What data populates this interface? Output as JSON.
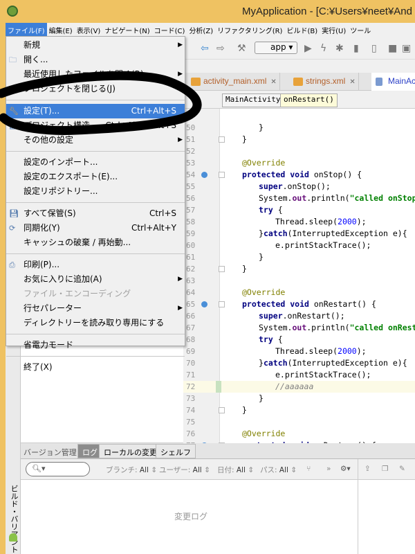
{
  "window": {
    "title": "MyApplication - [C:¥Users¥neet¥And"
  },
  "menubar": [
    "ファイル(F)",
    "編集(E)",
    "表示(V)",
    "ナビゲート(N)",
    "コード(C)",
    "分析(Z)",
    "リファクタリング(R)",
    "ビルド(B)",
    "実行(U)",
    "ツール"
  ],
  "toolbar": {
    "run_config": "app"
  },
  "tabs": [
    {
      "label": "activity_main.xml"
    },
    {
      "label": "strings.xml"
    },
    {
      "label": "MainAc"
    }
  ],
  "breadcrumb": [
    "MainActivity",
    "onRestart()"
  ],
  "file_menu": {
    "items": [
      {
        "label": "新規",
        "submenu": true
      },
      {
        "label": "開く...",
        "icon": "folder-icon"
      },
      {
        "label": "最近使用したファイルを開く(R)",
        "submenu": true
      },
      {
        "label": "プロジェクトを閉じる(J)"
      },
      {
        "sep": true
      },
      {
        "label": "設定(T)...",
        "shortcut": "Ctrl+Alt+S",
        "icon": "wrench-icon",
        "highlighted": true
      },
      {
        "label": "プロジェクト構造...",
        "shortcut": "Ctrl+Alt+Shift+S",
        "icon": "project-structure-icon"
      },
      {
        "label": "その他の設定",
        "submenu": true
      },
      {
        "sep": true
      },
      {
        "label": "設定のインポート..."
      },
      {
        "label": "設定のエクスポート(E)..."
      },
      {
        "label": "設定リポジトリー..."
      },
      {
        "sep": true
      },
      {
        "label": "すべて保管(S)",
        "shortcut": "Ctrl+S",
        "icon": "save-icon"
      },
      {
        "label": "同期化(Y)",
        "shortcut": "Ctrl+Alt+Y",
        "icon": "sync-icon"
      },
      {
        "label": "キャッシュの破棄 / 再始動..."
      },
      {
        "sep": true
      },
      {
        "label": "印刷(P)...",
        "icon": "print-icon"
      },
      {
        "label": "お気に入りに追加(A)",
        "submenu": true
      },
      {
        "label": "ファイル・エンコーディング",
        "disabled": true
      },
      {
        "label": "行セパレーター",
        "submenu": true
      },
      {
        "label": "ディレクトリーを読み取り専用にする"
      },
      {
        "sep": true
      },
      {
        "label": "省電力モード"
      },
      {
        "sep": true
      },
      {
        "label": "終了(X)"
      }
    ]
  },
  "code": [
    {
      "n": 50,
      "i": 2,
      "s": [
        [
          "p",
          "}"
        ]
      ]
    },
    {
      "n": 51,
      "i": 1,
      "s": [
        [
          "p",
          "}"
        ]
      ],
      "fold": true
    },
    {
      "n": 52,
      "i": 0,
      "s": []
    },
    {
      "n": 53,
      "i": 1,
      "s": [
        [
          "ann",
          "@Override"
        ]
      ]
    },
    {
      "n": 54,
      "i": 1,
      "s": [
        [
          "kw",
          "protected void "
        ],
        [
          "p",
          "onStop() {"
        ]
      ],
      "ovr": true,
      "fold": true
    },
    {
      "n": 55,
      "i": 2,
      "s": [
        [
          "kw",
          "super"
        ],
        [
          "p",
          ".onStop();"
        ]
      ]
    },
    {
      "n": 56,
      "i": 2,
      "s": [
        [
          "p",
          "System."
        ],
        [
          "fld",
          "out"
        ],
        [
          "p",
          ".println("
        ],
        [
          "str",
          "\"called onStop\""
        ],
        [
          "p",
          ");"
        ]
      ]
    },
    {
      "n": 57,
      "i": 2,
      "s": [
        [
          "kw",
          "try "
        ],
        [
          "p",
          "{"
        ]
      ]
    },
    {
      "n": 58,
      "i": 3,
      "s": [
        [
          "p",
          "Thread.sleep("
        ],
        [
          "num",
          "2000"
        ],
        [
          "p",
          ");"
        ]
      ]
    },
    {
      "n": 59,
      "i": 2,
      "s": [
        [
          "p",
          "}"
        ],
        [
          "kw",
          "catch"
        ],
        [
          "p",
          "(InterruptedException e){"
        ]
      ]
    },
    {
      "n": 60,
      "i": 3,
      "s": [
        [
          "p",
          "e.printStackTrace();"
        ]
      ]
    },
    {
      "n": 61,
      "i": 2,
      "s": [
        [
          "p",
          "}"
        ]
      ]
    },
    {
      "n": 62,
      "i": 1,
      "s": [
        [
          "p",
          "}"
        ]
      ],
      "fold": true
    },
    {
      "n": 63,
      "i": 0,
      "s": []
    },
    {
      "n": 64,
      "i": 1,
      "s": [
        [
          "ann",
          "@Override"
        ]
      ]
    },
    {
      "n": 65,
      "i": 1,
      "s": [
        [
          "kw",
          "protected void "
        ],
        [
          "p",
          "onRestart() {"
        ]
      ],
      "ovr": true,
      "fold": true
    },
    {
      "n": 66,
      "i": 2,
      "s": [
        [
          "kw",
          "super"
        ],
        [
          "p",
          ".onRestart();"
        ]
      ]
    },
    {
      "n": 67,
      "i": 2,
      "s": [
        [
          "p",
          "System."
        ],
        [
          "fld",
          "out"
        ],
        [
          "p",
          ".println("
        ],
        [
          "str",
          "\"called onRestart\""
        ],
        [
          "p",
          ");"
        ]
      ]
    },
    {
      "n": 68,
      "i": 2,
      "s": [
        [
          "kw",
          "try "
        ],
        [
          "p",
          "{"
        ]
      ]
    },
    {
      "n": 69,
      "i": 3,
      "s": [
        [
          "p",
          "Thread.sleep("
        ],
        [
          "num",
          "2000"
        ],
        [
          "p",
          ");"
        ]
      ]
    },
    {
      "n": 70,
      "i": 2,
      "s": [
        [
          "p",
          "}"
        ],
        [
          "kw",
          "catch"
        ],
        [
          "p",
          "(InterruptedException e){"
        ]
      ]
    },
    {
      "n": 71,
      "i": 3,
      "s": [
        [
          "p",
          "e.printStackTrace();"
        ]
      ]
    },
    {
      "n": 72,
      "i": 3,
      "s": [
        [
          "cmt",
          "//aaaaaa"
        ]
      ],
      "current": true
    },
    {
      "n": 73,
      "i": 2,
      "s": [
        [
          "p",
          "}"
        ]
      ]
    },
    {
      "n": 74,
      "i": 1,
      "s": [
        [
          "p",
          "}"
        ]
      ],
      "fold": true
    },
    {
      "n": 75,
      "i": 0,
      "s": []
    },
    {
      "n": 76,
      "i": 1,
      "s": [
        [
          "ann",
          "@Override"
        ]
      ]
    },
    {
      "n": 77,
      "i": 1,
      "s": [
        [
          "kw",
          "protected void "
        ],
        [
          "p",
          "onDestroy() {"
        ]
      ],
      "ovr": true,
      "fold": true
    }
  ],
  "bottom": {
    "label": "バージョン管理:",
    "tabs": [
      "ログ",
      "ローカルの変更",
      "シェルフ"
    ],
    "filters": [
      {
        "k": "ブランチ:",
        "v": "All"
      },
      {
        "k": "ユーザー:",
        "v": "All"
      },
      {
        "k": "日付:",
        "v": "All"
      },
      {
        "k": "パス:",
        "v": "All"
      }
    ],
    "empty_text": "変更ログ"
  },
  "side_tool": {
    "build_variants": "ビルド・バリアント"
  },
  "colors": {
    "accent": "#3d7fd8",
    "title_bar": "#efc262"
  }
}
